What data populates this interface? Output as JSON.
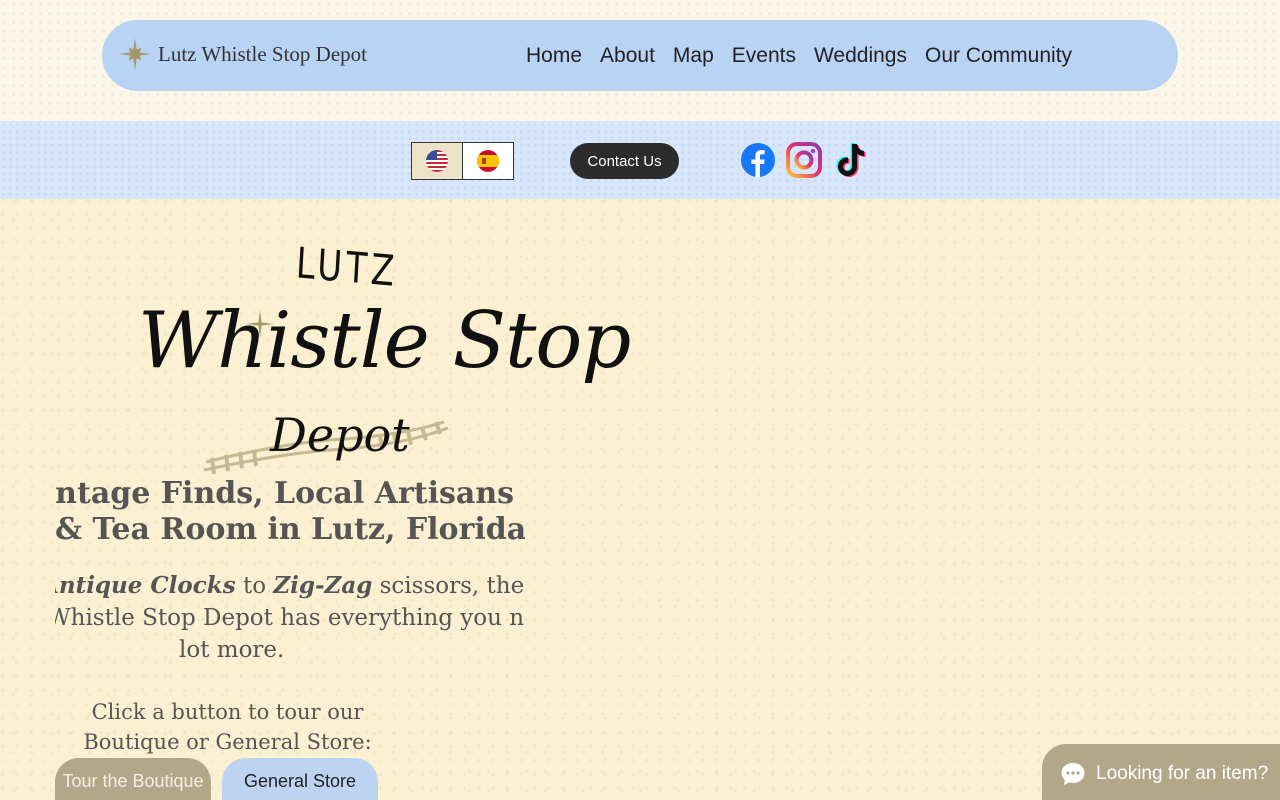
{
  "header": {
    "site_title": "Lutz Whistle Stop Depot",
    "nav": [
      "Home",
      "About",
      "Map",
      "Events",
      "Weddings",
      "Our Community"
    ]
  },
  "toolbar": {
    "languages": [
      "us-flag-icon",
      "es-flag-icon"
    ],
    "contact_label": "Contact Us",
    "social": [
      "facebook-icon",
      "instagram-icon",
      "tiktok-icon"
    ]
  },
  "logo": {
    "line1": "LUTZ",
    "line2": "Whistle Stop",
    "line3": "Depot"
  },
  "hero": {
    "heading_line1": "Vintage Finds, Local Artisans",
    "heading_line2": "& Tea Room in Lutz, Florida",
    "body_line1_em1": "Antique Clocks",
    "body_line1_mid": " to ",
    "body_line1_em2": "Zig-Zag",
    "body_line1_end": " scissors, the Lutz",
    "body_line2": "Whistle Stop Depot has everything you need and a",
    "body_line3": "lot more.",
    "tour_line1": "Click a button to tour our",
    "tour_line2": "Boutique or General Store:",
    "btn_boutique": "Tour the Boutique",
    "btn_general": "General Store"
  },
  "chat": {
    "label": "Looking for an item?"
  },
  "colors": {
    "nav_bg": "#b9d3f5",
    "accent_gold": "#b3a78a",
    "page_bg": "#fbf0d2"
  }
}
